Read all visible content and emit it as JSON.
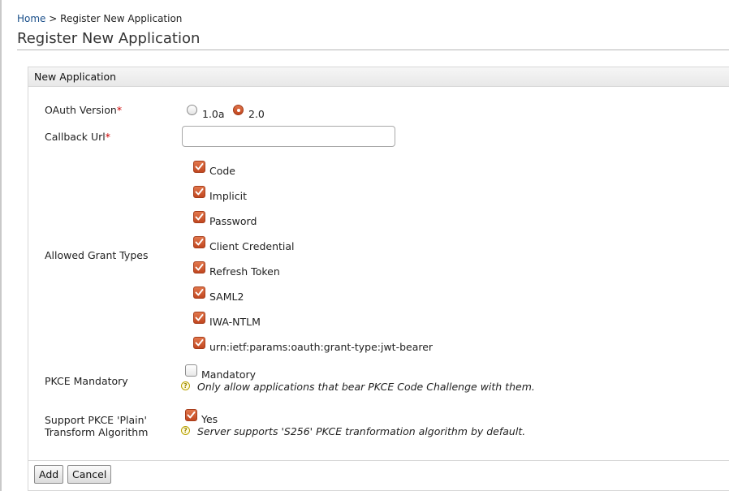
{
  "breadcrumb": {
    "home": "Home",
    "separator": ">",
    "current": "Register New Application"
  },
  "page": {
    "title": "Register New Application"
  },
  "panel": {
    "title": "New Application"
  },
  "form": {
    "oauth_version": {
      "label": "OAuth Version",
      "required_mark": "*",
      "options": [
        {
          "label": "1.0a",
          "selected": false
        },
        {
          "label": "2.0",
          "selected": true
        }
      ]
    },
    "callback_url": {
      "label": "Callback Url",
      "required_mark": "*",
      "value": ""
    },
    "grant_types": {
      "label": "Allowed Grant Types",
      "options": [
        {
          "label": "Code",
          "checked": true
        },
        {
          "label": "Implicit",
          "checked": true
        },
        {
          "label": "Password",
          "checked": true
        },
        {
          "label": "Client Credential",
          "checked": true
        },
        {
          "label": "Refresh Token",
          "checked": true
        },
        {
          "label": "SAML2",
          "checked": true
        },
        {
          "label": "IWA-NTLM",
          "checked": true
        },
        {
          "label": "urn:ietf:params:oauth:grant-type:jwt-bearer",
          "checked": true
        }
      ]
    },
    "pkce_mandatory": {
      "label": "PKCE Mandatory",
      "option_label": "Mandatory",
      "checked": false,
      "help": "Only allow applications that bear PKCE Code Challenge with them."
    },
    "pkce_plain": {
      "label_line1": "Support PKCE 'Plain'",
      "label_line2": "Transform Algorithm",
      "option_label": "Yes",
      "checked": true,
      "help": "Server supports 'S256' PKCE tranformation algorithm by default."
    }
  },
  "buttons": {
    "add": "Add",
    "cancel": "Cancel"
  },
  "colors": {
    "accent": "#c9542a",
    "link": "#1a4f8a",
    "required": "#cc0000"
  },
  "icons": {
    "help": "question-circle-icon",
    "check": "checkmark-icon"
  }
}
